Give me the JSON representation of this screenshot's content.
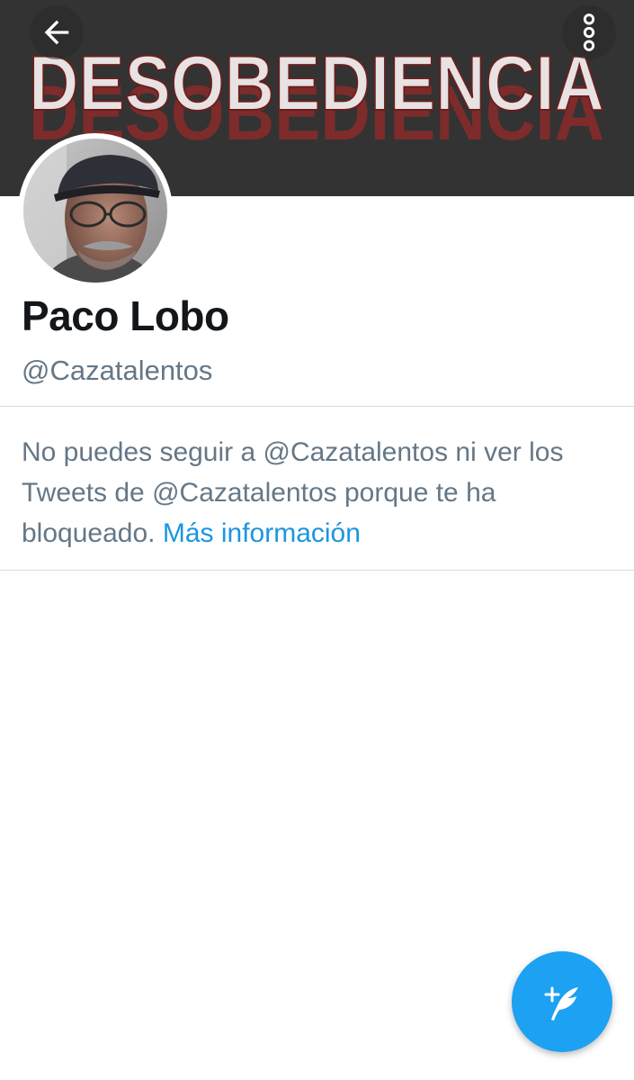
{
  "header": {
    "banner_text": "DESOBEDIENCIA",
    "back_icon": "arrow-left-icon",
    "menu_icon": "more-vertical-icon"
  },
  "profile": {
    "display_name": "Paco Lobo",
    "handle": "@Cazatalentos",
    "avatar_icon": "profile-photo"
  },
  "blocked_notice": {
    "message": "No puedes seguir a @Cazatalentos ni ver los Tweets de @Cazatalentos porque te ha bloqueado.",
    "link_text": "Más información"
  },
  "compose": {
    "icon": "compose-tweet-icon"
  },
  "colors": {
    "banner_bg": "#333333",
    "accent": "#1da1f2",
    "link": "#1b95e0",
    "secondary_text": "#657786",
    "primary_text": "#14171a"
  }
}
